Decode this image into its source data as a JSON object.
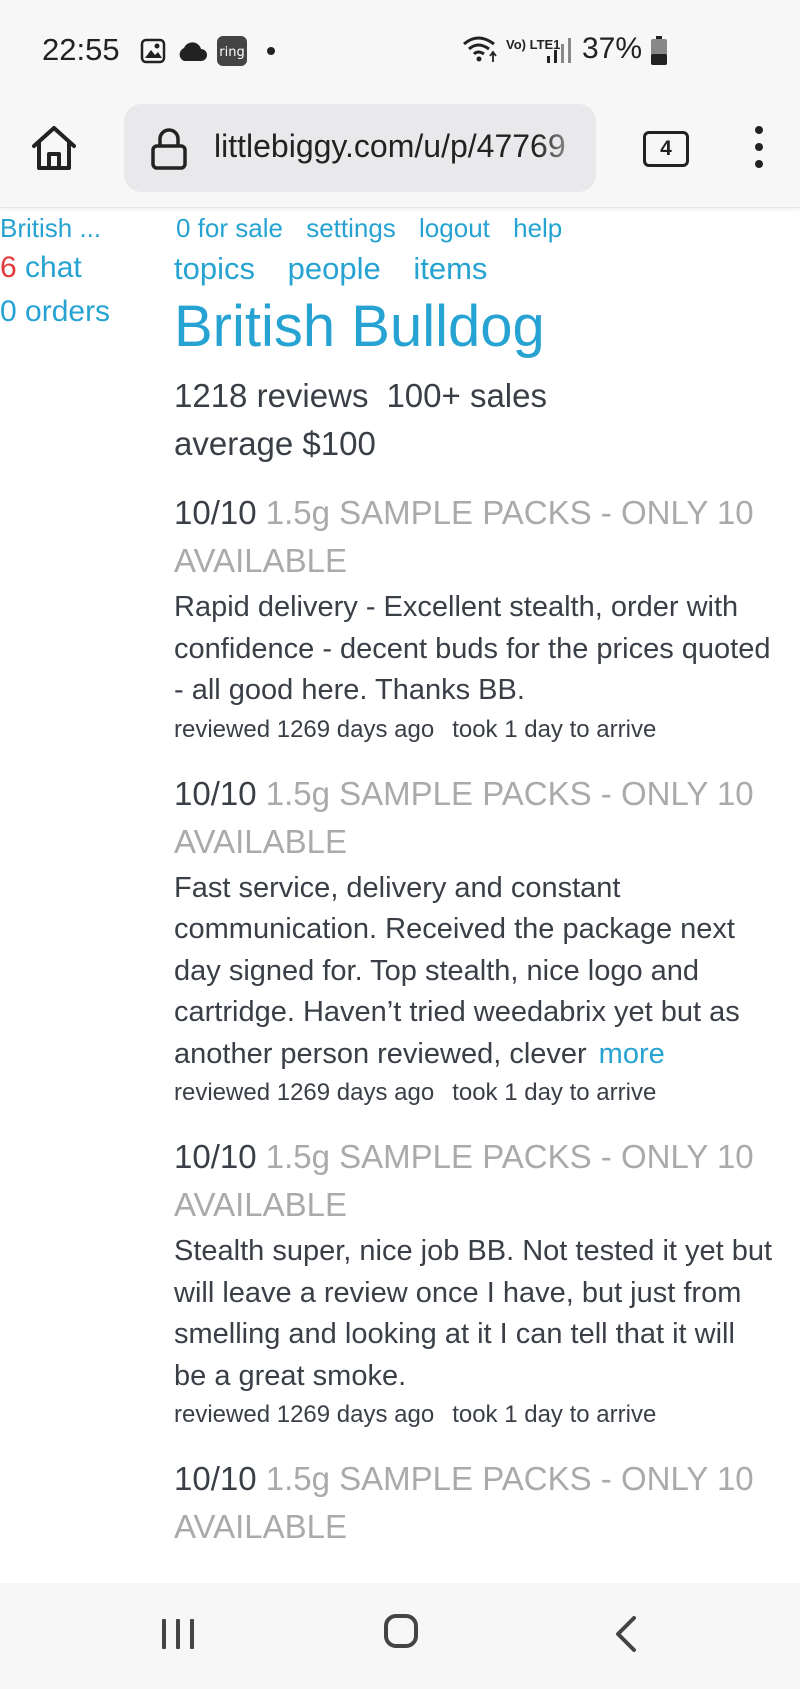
{
  "status_bar": {
    "time": "22:55",
    "notification_icons": [
      "image-icon",
      "cloud-icon",
      "ring-icon",
      "dot-icon"
    ],
    "ring_label": "ring",
    "network": "Vo) LTE1",
    "battery": "37%"
  },
  "browser": {
    "url": "littlebiggy.com/u/p/47769",
    "tab_count": "4"
  },
  "sidebar": {
    "user": "British ...",
    "chat_count": "6",
    "chat_label": " chat",
    "orders": "0 orders"
  },
  "top_links": [
    "0 for sale",
    "settings",
    "logout",
    "help"
  ],
  "nav_links": [
    "topics",
    "people",
    "items"
  ],
  "profile": {
    "title": "British Bulldog",
    "reviews": "1218 reviews",
    "sales": "100+ sales",
    "average": "average $100"
  },
  "reviews": [
    {
      "score": "10/10",
      "product": "1.5g SAMPLE PACKS - ONLY 10 AVAILABLE",
      "text": "Rapid delivery - Excellent stealth, order with confidence - decent buds for the prices quoted - all good here. Thanks BB.",
      "more": "",
      "reviewed": "reviewed 1269 days ago",
      "arrive": "took 1 day to arrive"
    },
    {
      "score": "10/10",
      "product": "1.5g SAMPLE PACKS - ONLY 10 AVAILABLE",
      "text": "Fast service, delivery and constant communication. Received the package next day signed for. Top stealth, nice logo and cartridge. Haven’t tried weedabrix yet but as another person reviewed, clever",
      "more": "more",
      "reviewed": "reviewed 1269 days ago",
      "arrive": "took 1 day to arrive"
    },
    {
      "score": "10/10",
      "product": "1.5g SAMPLE PACKS - ONLY 10 AVAILABLE",
      "text": "Stealth super, nice job BB. Not tested it yet but will leave a review once I have, but just from smelling and looking at it I can tell that it will be a great smoke.",
      "more": "",
      "reviewed": "reviewed 1269 days ago",
      "arrive": "took 1 day to arrive"
    },
    {
      "score": "10/10",
      "product": "1.5g SAMPLE PACKS - ONLY 10 AVAILABLE",
      "text": "",
      "more": "",
      "reviewed": "",
      "arrive": ""
    }
  ],
  "system_nav": [
    "recents-button",
    "home-button",
    "back-button"
  ],
  "colors": {
    "link": "#26a3d2",
    "chat_count": "#e23b3b",
    "product_muted": "#aaaaaa",
    "body_text": "#3a3f47"
  }
}
